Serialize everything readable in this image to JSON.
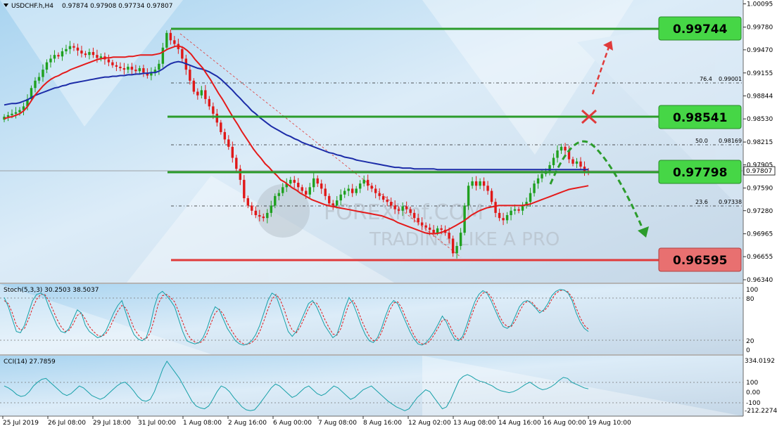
{
  "header": {
    "symbol": "USDCHF.h,H4",
    "ohlc": "0.97874 0.97908 0.97734 0.97807"
  },
  "price_axis": {
    "ticks": [
      "1.00095",
      "0.99780",
      "0.99470",
      "0.99155",
      "0.98844",
      "0.98530",
      "0.98215",
      "0.97905",
      "0.97590",
      "0.97280",
      "0.96965",
      "0.96655",
      "0.96340"
    ],
    "current_price": "0.97807"
  },
  "time_axis": {
    "ticks": [
      "25 Jul 2019",
      "26 Jul 08:00",
      "29 Jul 18:00",
      "31 Jul 00:00",
      "1 Aug 08:00",
      "2 Aug 16:00",
      "6 Aug 00:00",
      "7 Aug 08:00",
      "8 Aug 16:00",
      "12 Aug 02:00",
      "13 Aug 08:00",
      "14 Aug 16:00",
      "16 Aug 00:00",
      "19 Aug 10:00"
    ]
  },
  "levels": {
    "l1": "0.99744",
    "l2": "0.98541",
    "l3": "0.97798",
    "l4": "0.96595"
  },
  "fib": {
    "f764": "76.4",
    "f764_price": "0.99001",
    "f500": "50.0",
    "f500_price": "0.98169",
    "f236": "23.6",
    "f236_price": "0.97338"
  },
  "watermark": {
    "brand": "FOREXimf.COM",
    "tagline": "TRADING LIKE A PRO"
  },
  "stoch": {
    "label": "Stoch(5,3,3) 30.2503 38.5037",
    "ticks": [
      "100",
      "80",
      "20",
      "0"
    ]
  },
  "cci": {
    "label": "CCI(14) 27.7859",
    "ticks": [
      "334.0192",
      "100",
      "0.00",
      "-100",
      "-212.2274"
    ]
  },
  "colors": {
    "bull": "#1fa01f",
    "bear": "#e01818",
    "ma_fast": "#e41a1a",
    "ma_slow": "#1c2ca8",
    "level_green": "#2c9c2c",
    "level_red": "#e03a3a",
    "label_green": "#46d646",
    "label_red": "#e87070"
  },
  "chart_data": {
    "type": "candlestick",
    "title": "USDCHF.h,H4",
    "ylim": [
      0.9634,
      1.0011
    ],
    "ylabel": "",
    "xlabel": "",
    "closes": [
      0.9856,
      0.9858,
      0.986,
      0.9862,
      0.9865,
      0.987,
      0.988,
      0.9895,
      0.9905,
      0.991,
      0.992,
      0.993,
      0.9935,
      0.994,
      0.9938,
      0.9945,
      0.9948,
      0.9952,
      0.995,
      0.9946,
      0.9942,
      0.994,
      0.9944,
      0.994,
      0.9936,
      0.9938,
      0.9934,
      0.993,
      0.9926,
      0.9924,
      0.9922,
      0.992,
      0.9924,
      0.992,
      0.9918,
      0.9922,
      0.9916,
      0.9912,
      0.9916,
      0.992,
      0.9928,
      0.995,
      0.997,
      0.996,
      0.9955,
      0.9948,
      0.9935,
      0.992,
      0.9905,
      0.989,
      0.9885,
      0.9892,
      0.988,
      0.987,
      0.986,
      0.9848,
      0.9835,
      0.9825,
      0.9815,
      0.98,
      0.9785,
      0.977,
      0.9745,
      0.9735,
      0.9728,
      0.9722,
      0.972,
      0.9718,
      0.9725,
      0.9735,
      0.9748,
      0.9752,
      0.976,
      0.9765,
      0.977,
      0.9766,
      0.976,
      0.9755,
      0.975,
      0.976,
      0.9772,
      0.9765,
      0.9758,
      0.9748,
      0.9738,
      0.9735,
      0.9742,
      0.975,
      0.9755,
      0.9758,
      0.9752,
      0.9758,
      0.9765,
      0.977,
      0.9762,
      0.9758,
      0.9752,
      0.9748,
      0.9743,
      0.974,
      0.9735,
      0.973,
      0.9728,
      0.9734,
      0.973,
      0.9725,
      0.9718,
      0.9712,
      0.9708,
      0.9705,
      0.9702,
      0.9698,
      0.9704,
      0.9702,
      0.9698,
      0.969,
      0.967,
      0.968,
      0.9698,
      0.9735,
      0.9762,
      0.9768,
      0.9762,
      0.9768,
      0.9762,
      0.9755,
      0.974,
      0.9725,
      0.9718,
      0.9715,
      0.9722,
      0.9728,
      0.973,
      0.9728,
      0.9735,
      0.974,
      0.9752,
      0.9765,
      0.9772,
      0.9778,
      0.9782,
      0.979,
      0.98,
      0.981,
      0.9815,
      0.981,
      0.9798,
      0.9792,
      0.9795,
      0.9788,
      0.9782,
      0.9781
    ],
    "series": [
      {
        "name": "MA (fast)",
        "values": [
          0.9853,
          0.9855,
          0.9856,
          0.9858,
          0.986,
          0.9864,
          0.987,
          0.9878,
          0.9886,
          0.9892,
          0.9898,
          0.9903,
          0.9907,
          0.991,
          0.9912,
          0.9915,
          0.9917,
          0.992,
          0.9922,
          0.9924,
          0.9926,
          0.9928,
          0.993,
          0.9932,
          0.9934,
          0.9935,
          0.9936,
          0.9936,
          0.9937,
          0.9937,
          0.9937,
          0.9937,
          0.9938,
          0.9938,
          0.9939,
          0.994,
          0.994,
          0.994,
          0.994,
          0.9941,
          0.9942,
          0.9945,
          0.9948,
          0.995,
          0.9952,
          0.9952,
          0.995,
          0.9946,
          0.9941,
          0.9934,
          0.9928,
          0.9922,
          0.9914,
          0.9906,
          0.9897,
          0.9888,
          0.988,
          0.9871,
          0.9862,
          0.9853,
          0.9845,
          0.9836,
          0.9828,
          0.982,
          0.9812,
          0.9805,
          0.9799,
          0.9792,
          0.9787,
          0.9781,
          0.9776,
          0.977,
          0.9767,
          0.9763,
          0.9759,
          0.9756,
          0.9752,
          0.9749,
          0.9746,
          0.9743,
          0.9741,
          0.9739,
          0.9737,
          0.9735,
          0.9734,
          0.9733,
          0.9732,
          0.9731,
          0.973,
          0.9729,
          0.9728,
          0.9727,
          0.9726,
          0.9725,
          0.9724,
          0.9723,
          0.9722,
          0.9721,
          0.9719,
          0.9717,
          0.9715,
          0.9712,
          0.971,
          0.9708,
          0.9706,
          0.9704,
          0.9702,
          0.97,
          0.9698,
          0.9697,
          0.9697,
          0.9697,
          0.9698,
          0.97,
          0.9702,
          0.9705,
          0.9708,
          0.9711,
          0.9714,
          0.9718,
          0.9722,
          0.9725,
          0.9728,
          0.973,
          0.9732,
          0.9733,
          0.9734,
          0.9735,
          0.9735,
          0.9735,
          0.9735,
          0.9735,
          0.9735,
          0.9735,
          0.9736,
          0.9737,
          0.9739,
          0.9741,
          0.9743,
          0.9745,
          0.9747,
          0.9749,
          0.9751,
          0.9753,
          0.9755,
          0.9757,
          0.9758,
          0.9759,
          0.976,
          0.9761,
          0.9762
        ]
      },
      {
        "name": "MA (slow)",
        "values": [
          0.9872,
          0.9873,
          0.9874,
          0.9874,
          0.9875,
          0.9877,
          0.9879,
          0.9882,
          0.9885,
          0.9887,
          0.9889,
          0.9891,
          0.9893,
          0.9895,
          0.9896,
          0.9898,
          0.9899,
          0.9901,
          0.9902,
          0.9903,
          0.9904,
          0.9905,
          0.9906,
          0.9907,
          0.9908,
          0.9909,
          0.991,
          0.991,
          0.9911,
          0.9911,
          0.9912,
          0.9912,
          0.9913,
          0.9913,
          0.9914,
          0.9914,
          0.9915,
          0.9915,
          0.9916,
          0.9916,
          0.9918,
          0.9921,
          0.9925,
          0.9928,
          0.993,
          0.9931,
          0.993,
          0.9928,
          0.9926,
          0.9924,
          0.9922,
          0.9921,
          0.9919,
          0.9917,
          0.9914,
          0.9911,
          0.9907,
          0.9902,
          0.9897,
          0.9892,
          0.9886,
          0.9881,
          0.9875,
          0.987,
          0.9864,
          0.986,
          0.9855,
          0.9851,
          0.9847,
          0.9843,
          0.984,
          0.9837,
          0.9834,
          0.9831,
          0.9829,
          0.9826,
          0.9824,
          0.9821,
          0.9819,
          0.9817,
          0.9815,
          0.9813,
          0.9811,
          0.9809,
          0.9807,
          0.9806,
          0.9804,
          0.9803,
          0.9801,
          0.98,
          0.9799,
          0.9797,
          0.9796,
          0.9795,
          0.9794,
          0.9793,
          0.9792,
          0.9791,
          0.979,
          0.9789,
          0.9788,
          0.9787,
          0.9787,
          0.9786,
          0.9786,
          0.9786,
          0.9785,
          0.9785,
          0.9785,
          0.9785,
          0.9785,
          0.9785,
          0.9784,
          0.9784,
          0.9784,
          0.9784,
          0.9784,
          0.9784,
          0.9784,
          0.9784,
          0.9784,
          0.9784,
          0.9784,
          0.9784,
          0.9784,
          0.9784,
          0.9784,
          0.9784,
          0.9784,
          0.9784,
          0.9784,
          0.9784,
          0.9784,
          0.9784,
          0.9784,
          0.9784,
          0.9784,
          0.9784,
          0.9784,
          0.9784,
          0.9784,
          0.9784,
          0.9784,
          0.9784,
          0.9784,
          0.9784,
          0.9784,
          0.9784,
          0.9784,
          0.9784,
          0.9784,
          0.9784
        ]
      }
    ],
    "stoch_main": [
      85,
      70,
      50,
      30,
      28,
      40,
      60,
      80,
      90,
      92,
      88,
      70,
      55,
      40,
      30,
      28,
      35,
      50,
      65,
      60,
      40,
      30,
      25,
      20,
      22,
      30,
      45,
      60,
      72,
      80,
      60,
      40,
      25,
      18,
      15,
      20,
      40,
      70,
      90,
      95,
      88,
      80,
      70,
      50,
      30,
      15,
      12,
      10,
      12,
      20,
      35,
      55,
      70,
      65,
      50,
      35,
      25,
      15,
      10,
      8,
      10,
      15,
      25,
      40,
      60,
      80,
      92,
      88,
      70,
      50,
      30,
      22,
      30,
      45,
      60,
      75,
      80,
      70,
      55,
      40,
      30,
      20,
      25,
      45,
      68,
      85,
      75,
      58,
      40,
      25,
      15,
      12,
      20,
      35,
      55,
      72,
      80,
      75,
      60,
      45,
      30,
      18,
      10,
      8,
      12,
      20,
      30,
      42,
      55,
      45,
      30,
      18,
      15,
      22,
      40,
      60,
      78,
      90,
      96,
      92,
      80,
      65,
      50,
      38,
      35,
      40,
      55,
      70,
      78,
      80,
      75,
      68,
      60,
      65,
      75,
      88,
      95,
      98,
      97,
      92,
      80,
      60,
      45,
      35,
      30
    ],
    "stoch_signal": [
      80,
      75,
      60,
      40,
      32,
      35,
      50,
      68,
      82,
      90,
      90,
      80,
      65,
      50,
      38,
      30,
      32,
      42,
      56,
      60,
      50,
      38,
      30,
      24,
      22,
      26,
      36,
      50,
      63,
      72,
      68,
      52,
      35,
      25,
      18,
      18,
      28,
      50,
      75,
      88,
      90,
      85,
      78,
      62,
      45,
      28,
      18,
      13,
      11,
      15,
      26,
      44,
      60,
      66,
      58,
      44,
      32,
      22,
      14,
      10,
      9,
      12,
      18,
      30,
      47,
      66,
      82,
      90,
      82,
      66,
      46,
      32,
      28,
      38,
      52,
      67,
      77,
      76,
      65,
      50,
      37,
      26,
      24,
      35,
      56,
      75,
      80,
      68,
      50,
      35,
      22,
      15,
      16,
      28,
      46,
      64,
      76,
      78,
      68,
      52,
      38,
      24,
      14,
      10,
      10,
      15,
      25,
      36,
      48,
      50,
      38,
      24,
      17,
      18,
      32,
      52,
      70,
      84,
      92,
      94,
      86,
      72,
      56,
      44,
      38,
      38,
      48,
      62,
      74,
      79,
      78,
      70,
      64,
      63,
      70,
      82,
      92,
      96,
      97,
      94,
      85,
      68,
      52,
      40,
      34
    ],
    "cci": [
      60,
      40,
      10,
      -30,
      -50,
      -40,
      0,
      60,
      100,
      130,
      140,
      100,
      60,
      20,
      -20,
      -40,
      -20,
      20,
      60,
      40,
      0,
      -40,
      -60,
      -80,
      -60,
      -20,
      20,
      60,
      90,
      100,
      60,
      10,
      -50,
      -90,
      -100,
      -80,
      0,
      120,
      240,
      320,
      260,
      200,
      140,
      60,
      -20,
      -100,
      -150,
      -170,
      -180,
      -150,
      -80,
      0,
      60,
      40,
      0,
      -60,
      -110,
      -160,
      -190,
      -200,
      -190,
      -140,
      -80,
      -20,
      40,
      80,
      60,
      20,
      -20,
      -60,
      -40,
      0,
      40,
      60,
      20,
      -20,
      -40,
      -20,
      20,
      60,
      40,
      0,
      -40,
      -80,
      -60,
      -20,
      20,
      40,
      60,
      20,
      -20,
      -60,
      -100,
      -130,
      -160,
      -180,
      -200,
      -180,
      -120,
      -60,
      -20,
      20,
      0,
      -60,
      -120,
      -180,
      -160,
      -80,
      20,
      120,
      160,
      180,
      160,
      130,
      110,
      100,
      80,
      60,
      30,
      10,
      0,
      -10,
      0,
      20,
      50,
      80,
      100,
      70,
      40,
      20,
      30,
      50,
      80,
      120,
      150,
      140,
      100,
      80,
      60,
      40,
      30
    ]
  }
}
